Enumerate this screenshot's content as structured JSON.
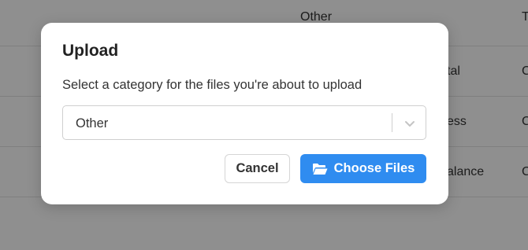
{
  "background_table": {
    "rows": [
      {
        "col_a": "Other",
        "col_b": "T"
      },
      {
        "col_a": "tal",
        "col_b": "C"
      },
      {
        "col_a": "ess",
        "col_b": "C"
      },
      {
        "col_a": "alance",
        "col_b": "C"
      },
      {
        "col_a": "",
        "col_b": ""
      }
    ]
  },
  "modal": {
    "title": "Upload",
    "description": "Select a category for the files you're about to upload",
    "category_select": {
      "selected": "Other",
      "icon": "chevron-down-icon"
    },
    "cancel_label": "Cancel",
    "choose_label": "Choose Files",
    "choose_icon": "folder-open-icon",
    "accent_color": "#2f8cf0"
  }
}
